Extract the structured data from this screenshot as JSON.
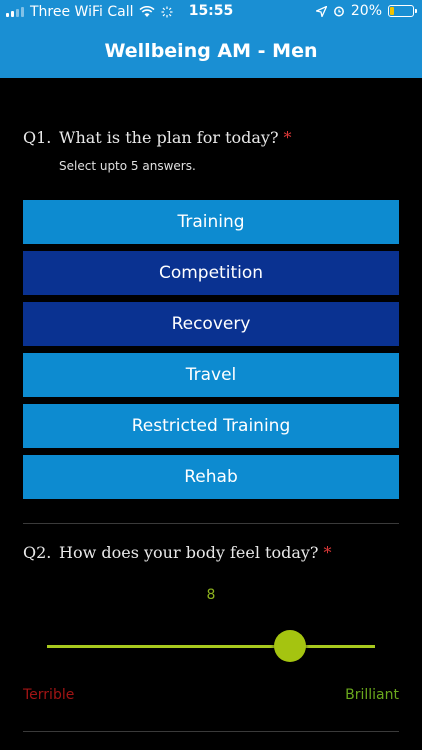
{
  "status_bar": {
    "carrier": "Three WiFi Call",
    "time": "15:55",
    "battery": "20%",
    "battery_level": 0.2,
    "icons": [
      "signal-icon",
      "wifi-icon",
      "brightness-icon",
      "location-arrow-icon",
      "alarm-icon",
      "battery-icon"
    ]
  },
  "header": {
    "title": "Wellbeing AM - Men"
  },
  "q1": {
    "number": "Q1.",
    "text": "What is the plan for today?",
    "required_mark": "*",
    "hint": "Select upto 5 answers.",
    "options": [
      {
        "label": "Training",
        "selected": false
      },
      {
        "label": "Competition",
        "selected": true
      },
      {
        "label": "Recovery",
        "selected": true
      },
      {
        "label": "Travel",
        "selected": false
      },
      {
        "label": "Restricted Training",
        "selected": false
      },
      {
        "label": "Rehab",
        "selected": false
      }
    ]
  },
  "q2": {
    "number": "Q2.",
    "text": "How does your body feel today?",
    "required_mark": "*",
    "value": "8",
    "min_label": "Terrible",
    "max_label": "Brilliant",
    "slider_fraction": 0.74
  },
  "colors": {
    "header_blue": "#1a8fd3",
    "option_blue": "#0d8bd0",
    "option_selected": "#0a3291",
    "slider_green": "#a5c410",
    "terrible_red": "#a11414",
    "brilliant_green": "#6aa81d"
  }
}
